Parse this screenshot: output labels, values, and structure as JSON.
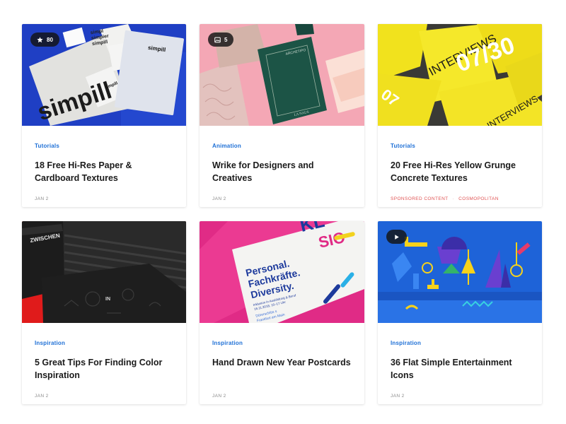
{
  "cards": [
    {
      "category": "Tutorials",
      "title": "18 Free Hi-Res Paper & Cardboard Textures",
      "date": "JAN 2",
      "badge": {
        "icon": "star-icon",
        "count": "80"
      }
    },
    {
      "category": "Animation",
      "title": "Wrike for Designers and Creatives",
      "date": "JAN 2",
      "badge": {
        "icon": "image-icon",
        "count": "5"
      }
    },
    {
      "category": "Tutorials",
      "title": "20 Free Hi-Res Yellow Grunge Concrete Textures",
      "sponsored": "SPONSORED CONTENT",
      "sponsor": "COSMOPOLITAN"
    },
    {
      "category": "Inspiration",
      "title": "5 Great Tips For Finding Color Inspiration",
      "date": "JAN 2"
    },
    {
      "category": "Inspiration",
      "title": "Hand Drawn New Year Postcards",
      "date": "JAN 2"
    },
    {
      "category": "Inspiration",
      "title": "36 Flat Simple Entertainment Icons",
      "date": "JAN 2",
      "badge": {
        "icon": "play-icon"
      }
    }
  ],
  "artwork": {
    "simpill": [
      "simpill",
      "simpl",
      "simpier",
      "simpill",
      "simpill"
    ],
    "interviews": [
      "INTERVIEWS",
      "07/30",
      "INTERVIEWS"
    ],
    "zwischen": "ZWISCHEN",
    "poster": [
      "Personal.",
      "Fachkräfte.",
      "Diversity.",
      "Inklusion in Ausbildung & Beruf",
      "16.11.2018, 10–17 Uhr",
      "Dürerschlös s",
      "Frankfurt am Main",
      "KL",
      "SIO"
    ]
  },
  "colors": {
    "accent": "#1d6fd6",
    "sponsored": "#e05454",
    "meta": "#8a8a8a"
  }
}
